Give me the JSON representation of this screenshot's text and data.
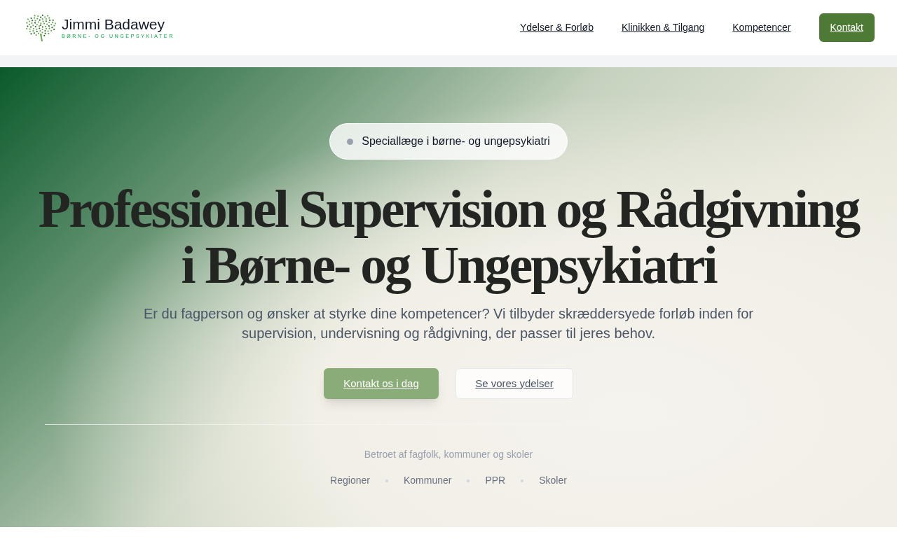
{
  "header": {
    "brand_name": "Jimmi Badawey",
    "brand_tagline": "BØRNE- OG UNGEPSYKIATER",
    "nav": [
      {
        "label": "Ydelser & Forløb",
        "kind": "link"
      },
      {
        "label": "Klinikken & Tilgang",
        "kind": "link"
      },
      {
        "label": "Kompetencer",
        "kind": "link"
      },
      {
        "label": "Kontakt",
        "kind": "button"
      }
    ]
  },
  "hero": {
    "badge": "Speciallæge i børne- og ungepsykiatri",
    "title_lines": [
      "Professionel Supervision og Rådgivning",
      "i Børne- og Ungepsykiatri"
    ],
    "subtitle": "Er du fagperson og ønsker at styrke dine kompetencer? Vi tilbyder skræddersyede forløb inden for supervision, undervisning og rådgivning, der passer til jeres behov.",
    "buttons": [
      {
        "label": "Kontakt os i dag",
        "kind": "primary"
      },
      {
        "label": "Se vores ydelser",
        "kind": "secondary"
      }
    ],
    "trust_caption": "Betroet af fagfolk, kommuner og skoler",
    "trust_items": [
      "Regioner",
      "Kommuner",
      "PPR",
      "Skoler"
    ]
  }
}
